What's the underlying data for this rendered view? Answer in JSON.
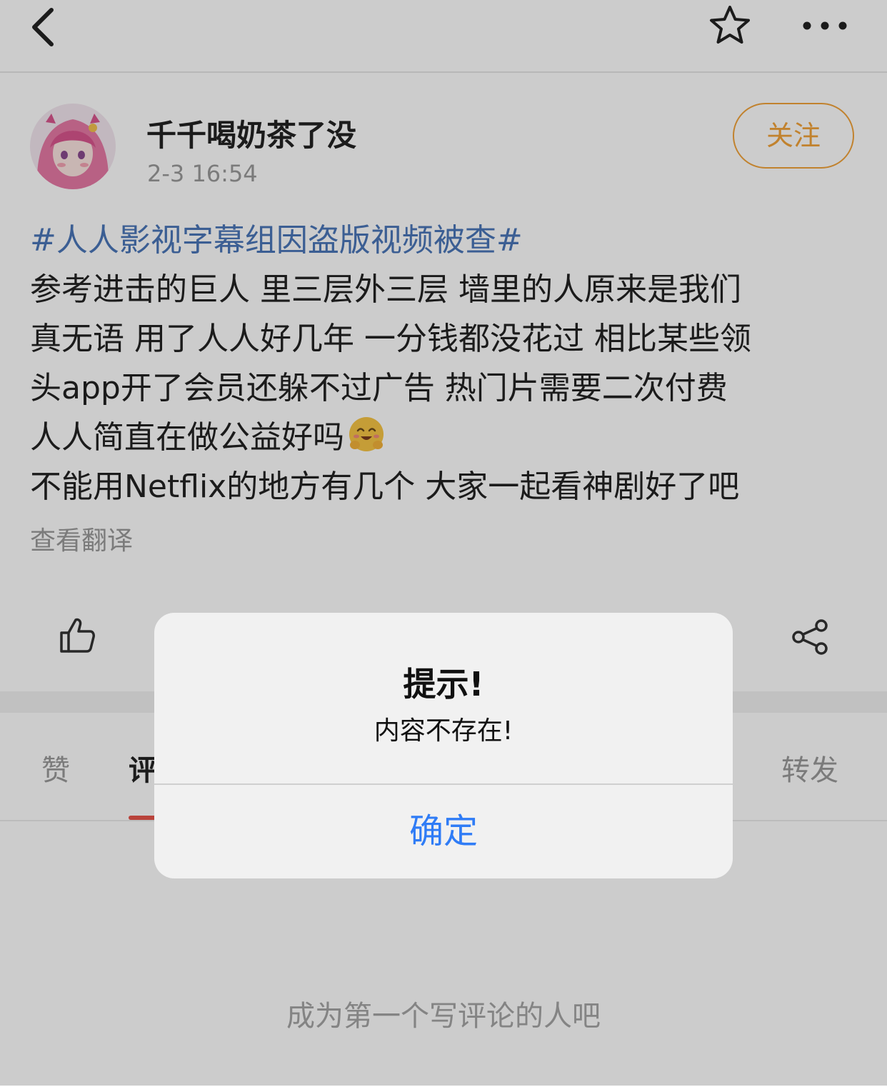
{
  "post": {
    "author_name": "千千喝奶茶了没",
    "time": "2-3 16:54",
    "follow_label": "关注",
    "hashtag": "#人人影视字幕组因盗版视频被查#",
    "lines": [
      "参考进击的巨人 里三层外三层 墙里的人原来是我们",
      "真无语 用了人人好几年 一分钱都没花过 相比某些领",
      "头app开了会员还躲不过广告  热门片需要二次付费",
      "人人简直在做公益好吗",
      "不能用Netflix的地方有几个 大家一起看神剧好了吧"
    ],
    "translate_label": "查看翻译"
  },
  "icons": {
    "back": "chevron-left-icon",
    "favorite": "star-icon",
    "more": "more-dots-icon",
    "like": "thumbs-up-icon",
    "share": "share-icon",
    "emoji": "hugging-face-emoji"
  },
  "tabs": {
    "likes": "赞",
    "comments": "评",
    "reposts": "转发"
  },
  "comments": {
    "empty_text": "成为第一个写评论的人吧"
  },
  "alert": {
    "title": "提示!",
    "message": "内容不存在!",
    "confirm_label": "确定"
  },
  "colors": {
    "hashtag": "#4a76b8",
    "follow": "#f2a33a",
    "tab_underline": "#e8544a",
    "alert_button": "#2f7cf6"
  }
}
